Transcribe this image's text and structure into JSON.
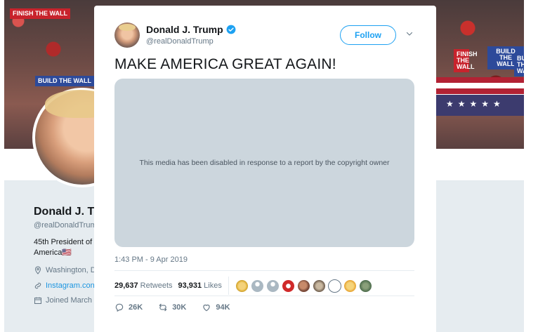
{
  "profile": {
    "name": "Donald J. T",
    "handle": "@realDonaldTrum",
    "bio": "45th President of America",
    "flag": "🇺🇸",
    "location": "Washington, D",
    "link": "Instagram.con",
    "joined": "Joined March",
    "signs": [
      "FINISH THE WALL",
      "BUILD THE WALL",
      "BUILD THE WALL",
      "FINISH THE WALL",
      "BUILD THE WALL"
    ]
  },
  "tweet": {
    "author_name": "Donald J. Trump",
    "author_handle": "@realDonaldTrump",
    "follow_label": "Follow",
    "text": "MAKE AMERICA GREAT AGAIN!",
    "media_message": "This media has been disabled in response to a report by the copyright owner",
    "timestamp": "1:43 PM - 9 Apr 2019",
    "retweets_count": "29,637",
    "retweets_label": "Retweets",
    "likes_count": "93,931",
    "likes_label": "Likes",
    "reply_count": "26K",
    "retweet_action_count": "30K",
    "like_action_count": "94K"
  },
  "icons": {
    "verified": "verified-badge-icon",
    "chevron": "chevron-down-icon",
    "reply": "reply-icon",
    "retweet": "retweet-icon",
    "like": "heart-icon",
    "location": "location-pin-icon",
    "link": "link-icon",
    "calendar": "calendar-icon"
  },
  "colors": {
    "accent": "#1da1f2",
    "media_placeholder": "#ccd6dd",
    "secondary_text": "#657786",
    "liker_colors": [
      "#e0b23a",
      "#aab8c2",
      "#aab8c2",
      "#d02a2a",
      "#7a4a3a",
      "#6b5a4a",
      "#ffffff",
      "#e8a838",
      "#4a6a4a"
    ]
  }
}
